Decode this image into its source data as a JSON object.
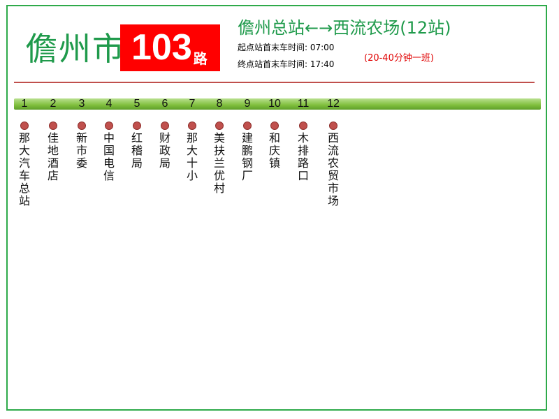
{
  "header": {
    "city": "儋州市",
    "route_number": "103",
    "route_suffix": "路",
    "route_line": "儋州总站←→西流农场(12站)",
    "time_line_1": "起点站首末车时间: 07:00",
    "time_line_2": "终点站首末车时间: 17:40",
    "frequency": "(20-40分钟一班)"
  },
  "colors": {
    "city_text": "#1f9a4b",
    "route_box": "#ff0000",
    "frequency_text": "#e00000",
    "divider": "#c0504d",
    "bar": "#7fbf3c",
    "stop_dot": "#c0504d",
    "frame": "#2eaa4a"
  },
  "stops": [
    {
      "num": "1",
      "name": "那大汽车总站"
    },
    {
      "num": "2",
      "name": "佳地酒店"
    },
    {
      "num": "3",
      "name": "新市委"
    },
    {
      "num": "4",
      "name": "中国电信"
    },
    {
      "num": "5",
      "name": "红稽局"
    },
    {
      "num": "6",
      "name": "财政局"
    },
    {
      "num": "7",
      "name": "那大十小"
    },
    {
      "num": "8",
      "name": "美扶兰优村"
    },
    {
      "num": "9",
      "name": "建鹏钢厂"
    },
    {
      "num": "10",
      "name": "和庆镇"
    },
    {
      "num": "11",
      "name": "木排路口"
    },
    {
      "num": "12",
      "name": "西流农贸市场"
    }
  ]
}
